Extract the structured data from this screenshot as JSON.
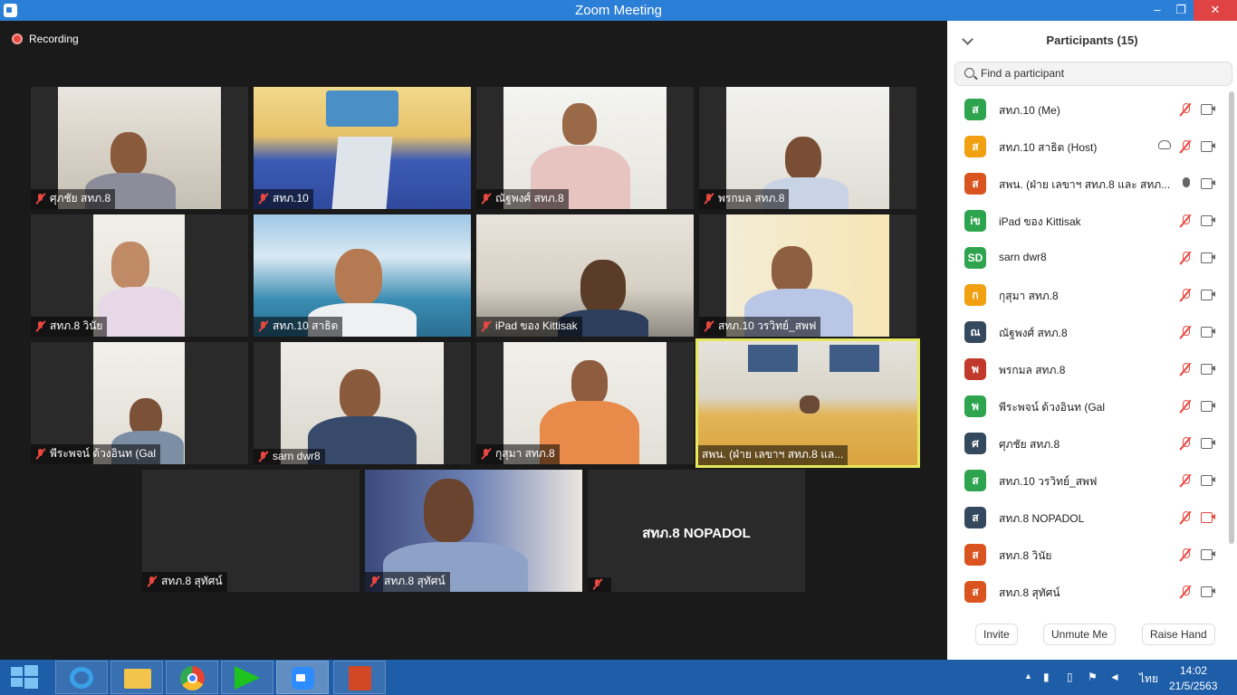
{
  "window": {
    "title": "Zoom Meeting",
    "minimize": "–",
    "maximize": "❐",
    "close": "✕"
  },
  "recording": "Recording",
  "tiles": [
    {
      "name": "ศุภชัย สทภ.8"
    },
    {
      "name": "สทภ.10"
    },
    {
      "name": "ณัฐพงศ์ สทภ.8"
    },
    {
      "name": "พรกมล สทภ.8"
    },
    {
      "name": "สทภ.8 วินัย"
    },
    {
      "name": "สทภ.10  สาธิต"
    },
    {
      "name": "iPad ของ Kittisak"
    },
    {
      "name": "สทภ.10 วรวิทย์_สพฟ"
    },
    {
      "name": "พีระพจน์ ด้วงอินท (Gal"
    },
    {
      "name": "sarn dwr8"
    },
    {
      "name": "กุสุมา สทภ.8"
    },
    {
      "name": "สพน. (ฝ่าย เลขาฯ สทภ.8 แล..."
    },
    {
      "name": "สทภ.8 สุทัศน์"
    },
    {
      "name": "สทภ.8 สุทัศน์"
    },
    {
      "name": "",
      "center_label": "สทภ.8 NOPADOL"
    }
  ],
  "panel": {
    "title": "Participants (15)",
    "search_placeholder": "Find a participant",
    "participants": [
      {
        "initial": "ส",
        "name": "สทภ.10 (Me)",
        "color": "#2ea44f",
        "mic": "off",
        "cam": "on"
      },
      {
        "initial": "ส",
        "name": "สทภ.10  สาธิต (Host)",
        "color": "#f0a010",
        "mic": "off",
        "cam": "on",
        "rec": true
      },
      {
        "initial": "ส",
        "name": "สพน. (ฝ่าย เลขาฯ สทภ.8 และ สทภ...",
        "color": "#d9541e",
        "mic": "on",
        "cam": "on"
      },
      {
        "initial": "iข",
        "name": "iPad ของ Kittisak",
        "color": "#2ea44f",
        "mic": "off",
        "cam": "on"
      },
      {
        "initial": "SD",
        "name": "sarn dwr8",
        "color": "#2ea44f",
        "mic": "off",
        "cam": "on"
      },
      {
        "initial": "ก",
        "name": "กุสุมา สทภ.8",
        "color": "#f0a010",
        "mic": "off",
        "cam": "on"
      },
      {
        "initial": "ณ",
        "name": "ณัฐพงศ์ สทภ.8",
        "color": "#34495e",
        "mic": "off",
        "cam": "on"
      },
      {
        "initial": "พ",
        "name": "พรกมล สทภ.8",
        "color": "#c0392b",
        "mic": "off",
        "cam": "on"
      },
      {
        "initial": "พ",
        "name": "พีระพจน์ ด้วงอินท (Gal",
        "color": "#2ea44f",
        "mic": "off",
        "cam": "on"
      },
      {
        "initial": "ศ",
        "name": "ศุภชัย สทภ.8",
        "color": "#34495e",
        "mic": "off",
        "cam": "on"
      },
      {
        "initial": "ส",
        "name": "สทภ.10 วรวิทย์_สพฟ",
        "color": "#2ea44f",
        "mic": "off",
        "cam": "on"
      },
      {
        "initial": "ส",
        "name": "สทภ.8 NOPADOL",
        "color": "#34495e",
        "mic": "off",
        "cam": "off"
      },
      {
        "initial": "ส",
        "name": "สทภ.8 วินัย",
        "color": "#d9541e",
        "mic": "off",
        "cam": "on"
      },
      {
        "initial": "ส",
        "name": "สทภ.8 สุทัศน์",
        "color": "#d9541e",
        "mic": "off",
        "cam": "on"
      }
    ],
    "buttons": {
      "invite": "Invite",
      "unmute": "Unmute Me",
      "raise": "Raise Hand"
    }
  },
  "taskbar": {
    "lang": "ไทย",
    "time": "14:02",
    "date": "21/5/2563"
  }
}
